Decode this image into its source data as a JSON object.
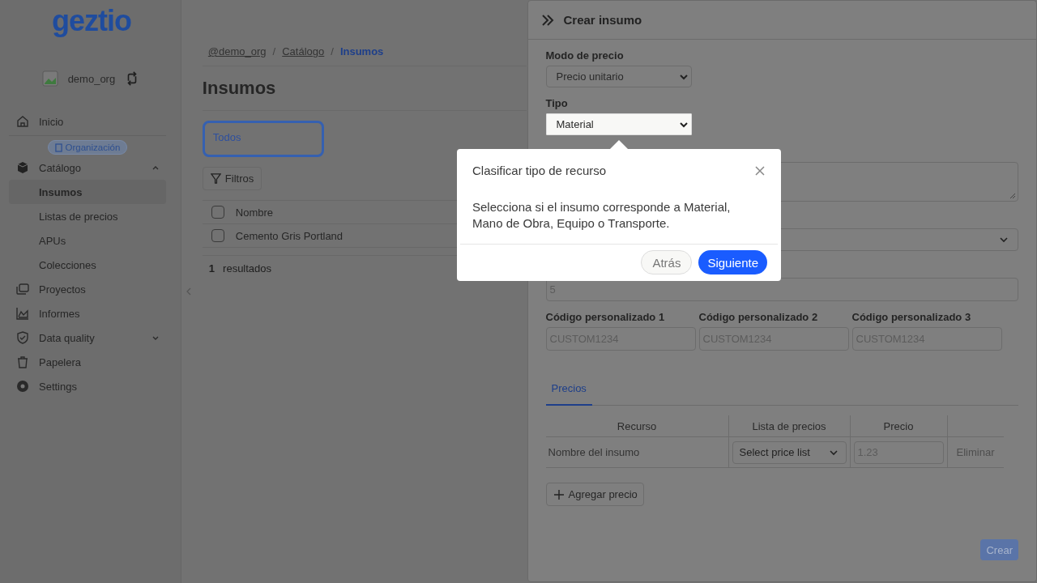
{
  "sidebar": {
    "logo": "geztio",
    "org": {
      "name": "demo_org"
    },
    "top_items": [
      {
        "label": "Inicio",
        "selected": false
      }
    ],
    "section_badge": "Organización",
    "items": [
      {
        "label": "Catálogo",
        "expanded": true,
        "children": [
          {
            "label": "Insumos",
            "selected": true
          },
          {
            "label": "Listas de precios",
            "selected": false
          },
          {
            "label": "APUs",
            "selected": false
          },
          {
            "label": "Colecciones",
            "selected": false
          }
        ]
      },
      {
        "label": "Proyectos"
      },
      {
        "label": "Informes"
      },
      {
        "label": "Data quality",
        "expanded": false
      },
      {
        "label": "Papelera"
      },
      {
        "label": "Settings"
      }
    ]
  },
  "main": {
    "breadcrumb_separator": "/",
    "breadcrumbs": [
      {
        "label": "@demo_org",
        "current": false
      },
      {
        "label": "Catálogo",
        "current": false
      },
      {
        "label": "Insumos",
        "current": true
      }
    ],
    "title": "Insumos",
    "filter_tabs": [
      {
        "label": "Todos",
        "selected": true
      }
    ],
    "filters_button": "Filtros",
    "table": {
      "columns": [
        "Nombre"
      ],
      "header_checked": false,
      "rows": [
        {
          "name": "Cemento Gris Portland",
          "checked": false
        }
      ]
    },
    "count": "1",
    "count_label": "resultados"
  },
  "panel": {
    "title": "Crear insumo",
    "price_mode": {
      "label": "Modo de precio",
      "value": "Precio unitario"
    },
    "type": {
      "label": "Tipo",
      "value": "Material"
    },
    "hidden_quantity": {
      "placeholder": "5"
    },
    "custom_codes": [
      {
        "label": "Código personalizado 1",
        "placeholder": "CUSTOM1234"
      },
      {
        "label": "Código personalizado 2",
        "placeholder": "CUSTOM1234"
      },
      {
        "label": "Código personalizado 3",
        "placeholder": "CUSTOM1234"
      }
    ],
    "tabs": [
      {
        "label": "Precios",
        "selected": true
      }
    ],
    "prices_table": {
      "columns": [
        "Recurso",
        "Lista de precios",
        "Precio"
      ],
      "rows": [
        {
          "resource": "Nombre del insumo",
          "price_list": "Select price list",
          "price_placeholder": "1.23",
          "delete": "Eliminar",
          "delete_disabled": true
        }
      ]
    },
    "add_price": "Agregar precio",
    "submit": "Crear"
  },
  "tour": {
    "title": "Clasificar tipo de recurso",
    "body": "Selecciona si el insumo corresponde a Material, Mano de Obra, Equipo o Transporte.",
    "back": "Atrás",
    "next": "Siguiente"
  }
}
